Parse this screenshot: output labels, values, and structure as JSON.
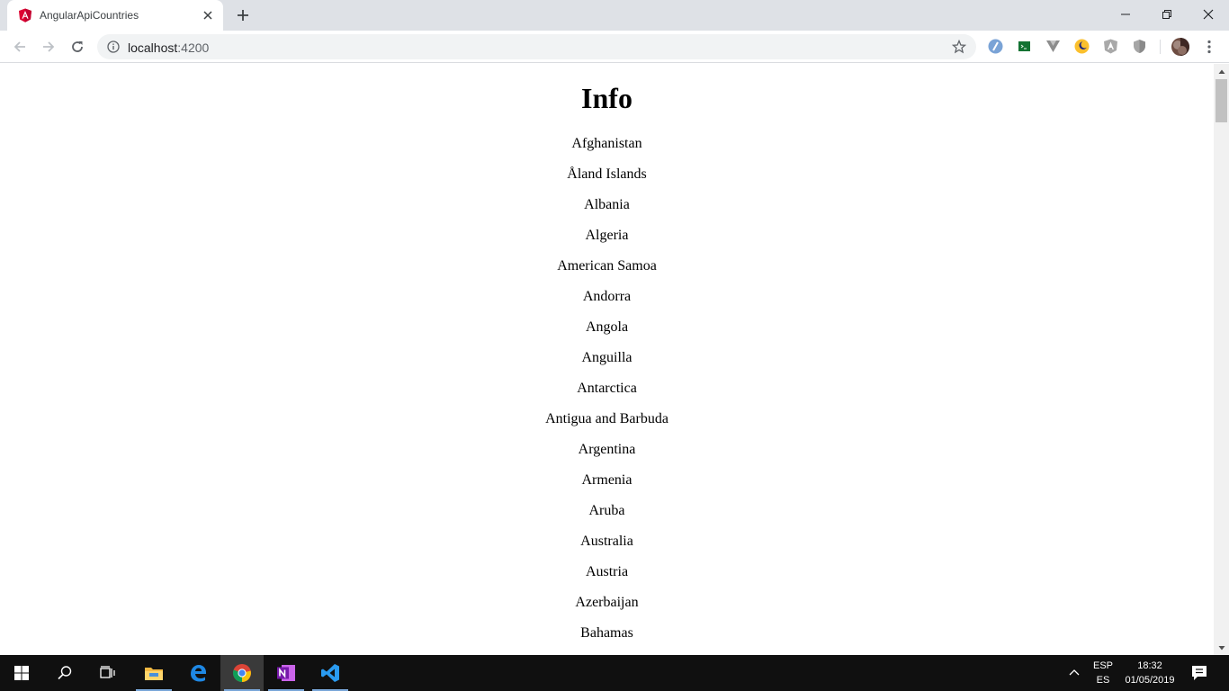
{
  "browser": {
    "tab": {
      "title": "AngularApiCountries"
    },
    "address_bar": {
      "host": "localhost",
      "port": ":4200"
    }
  },
  "page": {
    "heading": "Info",
    "countries": [
      "Afghanistan",
      "Åland Islands",
      "Albania",
      "Algeria",
      "American Samoa",
      "Andorra",
      "Angola",
      "Anguilla",
      "Antarctica",
      "Antigua and Barbuda",
      "Argentina",
      "Armenia",
      "Aruba",
      "Australia",
      "Austria",
      "Azerbaijan",
      "Bahamas"
    ]
  },
  "taskbar": {
    "apps": [
      "windows-start-icon",
      "search-icon",
      "task-view-icon",
      "file-explorer-icon",
      "edge-icon",
      "chrome-icon",
      "onenote-icon",
      "vscode-icon"
    ],
    "language": {
      "code": "ESP",
      "layout": "ES"
    },
    "clock": {
      "time": "18:32",
      "date": "01/05/2019"
    }
  },
  "colors": {
    "tabstrip": "#dee1e6",
    "omnibox": "#f1f3f4",
    "taskbar": "#101010",
    "angular_red": "#dd0031"
  }
}
